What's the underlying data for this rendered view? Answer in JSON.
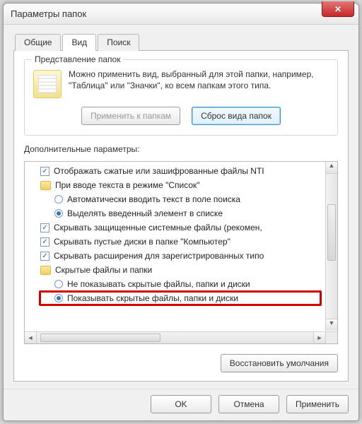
{
  "window": {
    "title": "Параметры папок"
  },
  "tabs": {
    "general": "Общие",
    "view": "Вид",
    "search": "Поиск"
  },
  "group": {
    "legend": "Представление папок",
    "desc": "Можно применить вид, выбранный для этой папки, например, \"Таблица\" или \"Значки\", ко всем папкам этого типа.",
    "apply": "Применить к папкам",
    "reset": "Сброс вида папок"
  },
  "advanced": {
    "label": "Дополнительные параметры:",
    "items": {
      "show_compressed": "Отображать сжатые или зашифрованные файлы NTI",
      "search_mode": "При вводе текста в режиме \"Список\"",
      "search_auto": "Автоматически вводить текст в поле поиска",
      "search_highlight": "Выделять введенный элемент в списке",
      "hide_protected": "Скрывать защищенные системные файлы (рекомен,",
      "hide_empty": "Скрывать пустые диски в папке \"Компьютер\"",
      "hide_ext": "Скрывать расширения для зарегистрированных типо",
      "hidden_files": "Скрытые файлы и папки",
      "dont_show": "Не показывать скрытые файлы, папки и диски",
      "show_hidden": "Показывать скрытые файлы, папки и диски"
    }
  },
  "buttons": {
    "restore": "Восстановить умолчания",
    "ok": "OK",
    "cancel": "Отмена",
    "apply": "Применить"
  }
}
